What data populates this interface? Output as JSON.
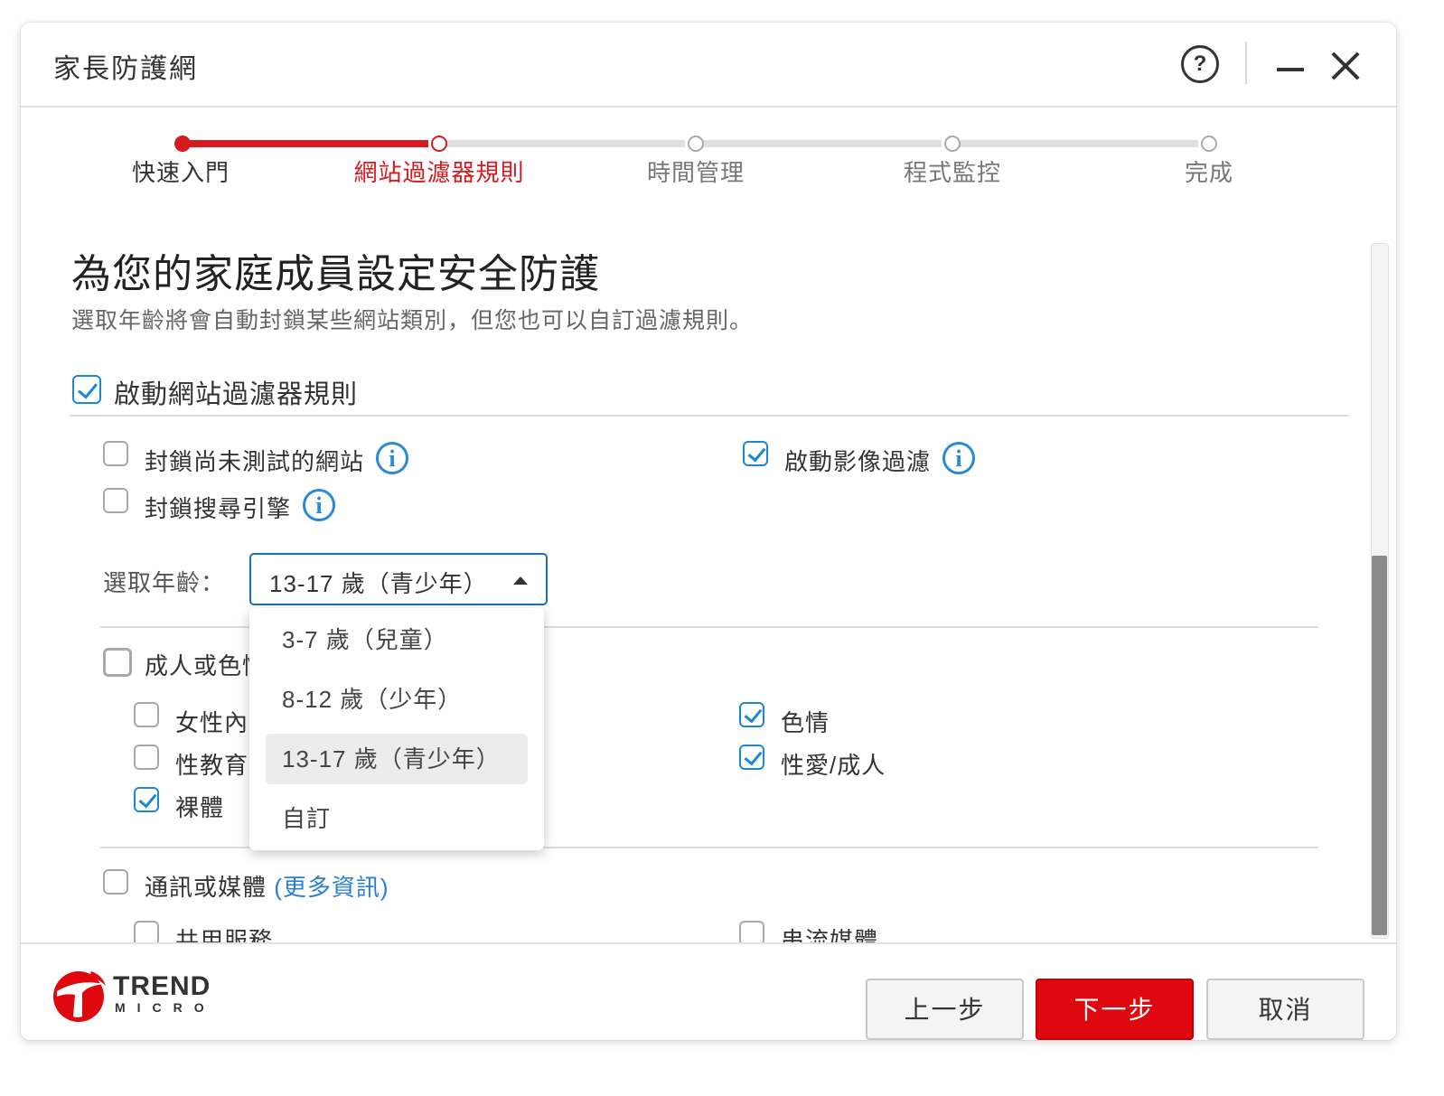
{
  "window": {
    "title": "家長防護網"
  },
  "titlebar": {
    "help_icon": "?"
  },
  "stepper": {
    "steps": [
      {
        "label": "快速入門",
        "state": "done"
      },
      {
        "label": "網站過濾器規則",
        "state": "current"
      },
      {
        "label": "時間管理",
        "state": "pending"
      },
      {
        "label": "程式監控",
        "state": "pending"
      },
      {
        "label": "完成",
        "state": "pending"
      }
    ]
  },
  "main": {
    "title": "為您的家庭成員設定安全防護",
    "subtitle": "選取年齡將會自動封鎖某些網站類別，但您也可以自訂過濾規則。",
    "enable_filter": {
      "label": "啟動網站過濾器規則",
      "checked": true
    },
    "options": [
      {
        "label": "封鎖尚未測試的網站",
        "checked": false
      },
      {
        "label": "封鎖搜尋引擎",
        "checked": false
      },
      {
        "label": "啟動影像過濾",
        "checked": true
      }
    ],
    "info_icon_glyph": "i",
    "age": {
      "label": "選取年齡：",
      "selected": "13-17 歲（青少年）",
      "options": [
        "3-7 歲（兒童）",
        "8-12 歲（少年）",
        "13-17 歲（青少年）",
        "自訂"
      ]
    },
    "categories": {
      "adult": {
        "label": "成人或色情",
        "items_left": [
          {
            "label": "女性內衣",
            "checked": false
          },
          {
            "label": "性教育",
            "checked": false
          },
          {
            "label": "裸體",
            "checked": true
          }
        ],
        "items_right": [
          {
            "label": "色情",
            "checked": true
          },
          {
            "label": "性愛/成人",
            "checked": true
          }
        ]
      },
      "media": {
        "label": "通訊或媒體",
        "more_link": "(更多資訊)",
        "item_left": "共用服務",
        "item_right": "串流媒體"
      }
    }
  },
  "footer": {
    "brand_line1": "TREND",
    "brand_line2": "MICRO",
    "back_label": "上一步",
    "next_label": "下一步",
    "cancel_label": "取消"
  },
  "colors": {
    "accent_red": "#d71920",
    "check_blue": "#1a87d8",
    "link_blue": "#2a7fd0"
  }
}
